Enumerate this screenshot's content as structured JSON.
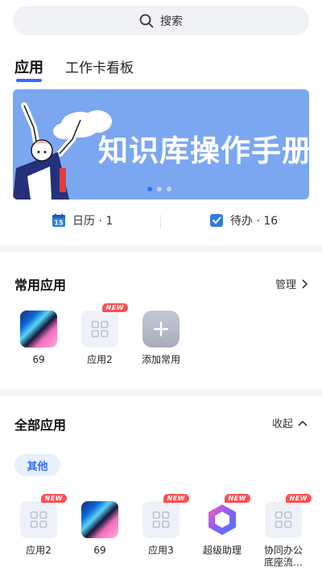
{
  "search": {
    "placeholder": "搜索"
  },
  "tabs": [
    {
      "label": "应用"
    },
    {
      "label": "工作卡看板"
    }
  ],
  "banner": {
    "title": "知识库操作手册",
    "dots": 3,
    "active_dot": 0
  },
  "quick": [
    {
      "label": "日历 · 1"
    },
    {
      "label": "待办 · 16"
    }
  ],
  "common": {
    "title": "常用应用",
    "action": "管理",
    "apps": [
      {
        "label": "69"
      },
      {
        "label": "应用2",
        "badge": "NEW"
      },
      {
        "label": "添加常用"
      }
    ]
  },
  "all": {
    "title": "全部应用",
    "action": "收起",
    "category": "其他",
    "apps": [
      {
        "label": "应用2",
        "badge": "NEW"
      },
      {
        "label": "69"
      },
      {
        "label": "应用3",
        "badge": "NEW"
      },
      {
        "label": "超级助理",
        "badge": "NEW"
      },
      {
        "label": "协同办公底座流…",
        "badge": "NEW"
      }
    ]
  },
  "colors": {
    "accent": "#2f6bff",
    "badge": "#ff4d4f",
    "banner": "#7ba7f0"
  }
}
